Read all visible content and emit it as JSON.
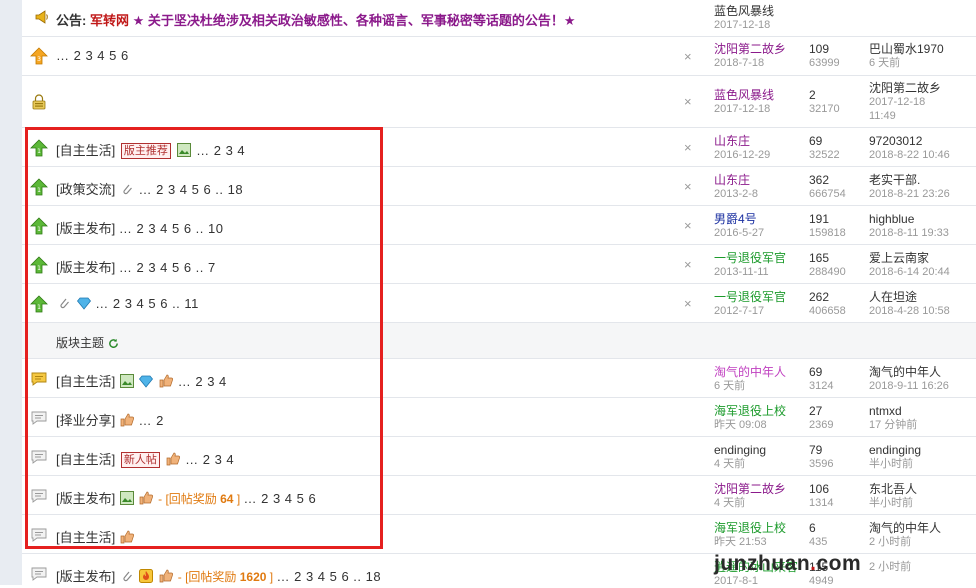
{
  "announcement": {
    "prefix": "公告:",
    "site": "军转网",
    "text": "★ 关于坚决杜绝涉及相关政治敏感性、各种谣言、军事秘密等话题的公告！★",
    "author": "蓝色风暴线",
    "date": "2017-12-18"
  },
  "top_rows": [
    {
      "title": "",
      "pages": "… 2 3 4 5 6",
      "close": "×",
      "author": "沈阳第二故乡",
      "date": "2018-7-18",
      "replies": "109",
      "views": "63999",
      "last_user": "巴山蜀水1970",
      "last_time": "6 天前"
    },
    {
      "title": "",
      "pages": "",
      "close": "×",
      "author": "蓝色风暴线",
      "date": "2017-12-18",
      "replies": "2",
      "views": "32170",
      "last_user": "沈阳第二故乡",
      "last_time": "2017-12-18",
      "last_time2": "11:49"
    }
  ],
  "sticky_rows": [
    {
      "tag": "[自主生活]",
      "badge": "版主推荐",
      "pages": "… 2 3 4",
      "close": "×",
      "author": "山东庄",
      "date": "2016-12-29",
      "replies": "69",
      "views": "32522",
      "last_user": "97203012",
      "last_time": "2018-8-22 10:46"
    },
    {
      "tag": "[政策交流]",
      "pages": "… 2 3 4 5 6 .. 18",
      "close": "×",
      "author": "山东庄",
      "date": "2013-2-8",
      "replies": "362",
      "views": "666754",
      "last_user": "老实干部.",
      "last_time": "2018-8-21 23:26"
    },
    {
      "tag": "[版主发布]",
      "pages": "… 2 3 4 5 6 .. 10",
      "close": "×",
      "author": "男爵4号",
      "date": "2016-5-27",
      "replies": "191",
      "views": "159818",
      "last_user": "highblue",
      "last_time": "2018-8-11 19:33"
    },
    {
      "tag": "[版主发布]",
      "pages": "… 2 3 4 5 6 .. 7",
      "close": "×",
      "author": "一号退役军官",
      "date": "2013-11-11",
      "replies": "165",
      "views": "288490",
      "last_user": "爱上云南家",
      "last_time": "2018-6-14 20:44"
    },
    {
      "tag": "",
      "pages": "… 2 3 4 5 6 .. 11",
      "close": "×",
      "author": "一号退役军官",
      "date": "2012-7-17",
      "replies": "262",
      "views": "406658",
      "last_user": "人在坦途",
      "last_time": "2018-4-28 10:58"
    }
  ],
  "section": {
    "label": "版块主题"
  },
  "normal_rows": [
    {
      "tag": "[自主生活]",
      "pages": "… 2 3 4",
      "author": "淘气的中年人",
      "date": "6 天前",
      "replies": "69",
      "views": "3124",
      "last_user": "淘气的中年人",
      "last_time": "2018-9-11 16:26"
    },
    {
      "tag": "[择业分享]",
      "pages": "… 2",
      "author": "海军退役上校",
      "date": "昨天 09:08",
      "replies": "27",
      "views": "2369",
      "last_user": "ntmxd",
      "last_time": "17 分钟前"
    },
    {
      "tag": "[自主生活]",
      "badge": "新人帖",
      "pages": "… 2 3 4",
      "author": "endinging",
      "date": "4 天前",
      "replies": "79",
      "views": "3596",
      "last_user": "endinging",
      "last_time": "半小时前"
    },
    {
      "tag": "[版主发布]",
      "reward_label": "- [回帖奖励",
      "reward_num": "64",
      "reward_close": "]",
      "pages": "… 2 3 4 5 6",
      "author": "沈阳第二故乡",
      "date": "4 天前",
      "replies": "106",
      "views": "1314",
      "last_user": "东北吾人",
      "last_time": "半小时前"
    },
    {
      "tag": "[自主生活]",
      "pages": "",
      "author": "海军退役上校",
      "date": "昨天 21:53",
      "replies": "6",
      "views": "435",
      "last_user": "淘气的中年人",
      "last_time": "2 小时前"
    },
    {
      "tag": "[版主发布]",
      "reward_label": "- [回帖奖励",
      "reward_num": "1620",
      "reward_close": "]",
      "pages": "… 2 3 4 5 6 .. 18",
      "author": "逍遥的冰山来客",
      "date": "2017-8-1",
      "replies": "115",
      "views": "4949",
      "last_user": "",
      "last_time": "2 小时前"
    }
  ],
  "watermark": {
    "pre": "junzhuan",
    "dot": ".",
    "post": "com"
  },
  "colors": {
    "highlight": "#e5201f",
    "reward": "#e07a10",
    "badge": "#b03030"
  }
}
